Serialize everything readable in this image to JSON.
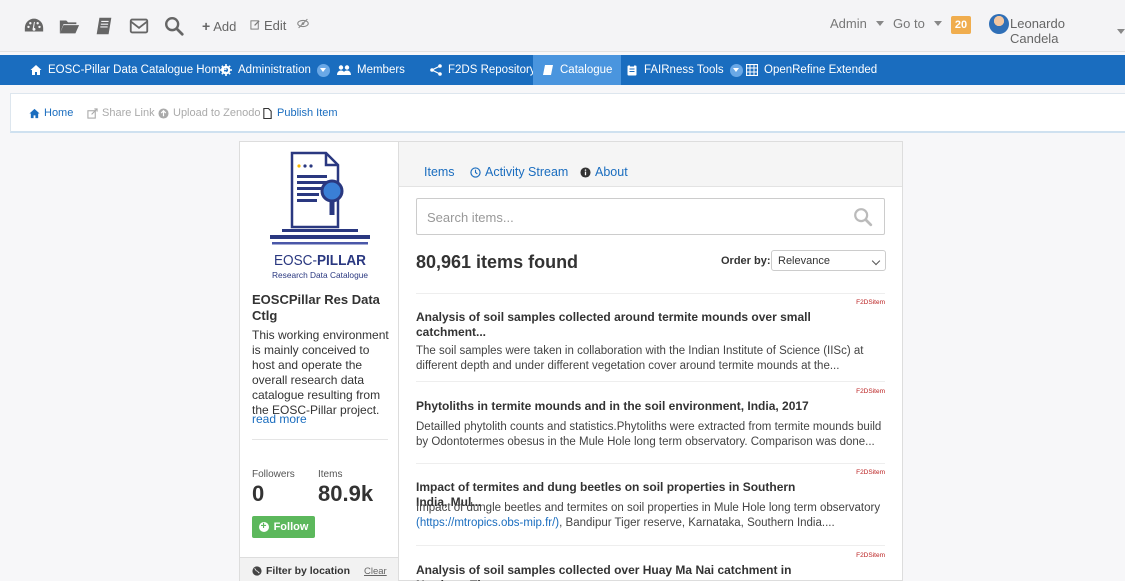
{
  "toolbar": {
    "add_label": "Add",
    "edit_label": "Edit",
    "admin_label": "Admin",
    "goto_label": "Go to",
    "notifications": "20",
    "user_name": "Leonardo Candela"
  },
  "nav": {
    "items": [
      {
        "label": "EOSC-Pillar Data Catalogue Home"
      },
      {
        "label": "Administration"
      },
      {
        "label": "Members"
      },
      {
        "label": "F2DS Repository"
      },
      {
        "label": "Catalogue"
      },
      {
        "label": "FAIRness Tools"
      },
      {
        "label": "OpenRefine Extended"
      }
    ]
  },
  "subbar": {
    "home": "Home",
    "share": "Share Link",
    "upload": "Upload to Zenodo",
    "publish": "Publish Item"
  },
  "org": {
    "logo_title_1": "EOSC-",
    "logo_title_2": "PILLAR",
    "logo_subtitle": "Research Data Catalogue",
    "name": "EOSCPillar Res Data Ctlg",
    "description": "This working environment is mainly conceived to host and operate the overall research data catalogue resulting from the EOSC-Pillar project.",
    "read_more": "read more",
    "followers_label": "Followers",
    "followers": "0",
    "items_label": "Items",
    "items": "80.9k",
    "follow_label": "Follow",
    "filter_label": "Filter by location",
    "filter_clear": "Clear"
  },
  "main": {
    "tabs": [
      {
        "label": "Items"
      },
      {
        "label": "Activity Stream"
      },
      {
        "label": "About"
      }
    ],
    "search_placeholder": "Search items...",
    "count": "80,961 items found",
    "order_label": "Order by:",
    "order_value": "Relevance",
    "results": [
      {
        "tag": "F2DSitem",
        "title": "Analysis of soil samples collected around termite mounds over small catchment...",
        "description": "The soil samples were taken in collaboration with the Indian Institute of Science (IISc) at different depth and under different vegetation cover around termite mounds at the..."
      },
      {
        "tag": "F2DSitem",
        "title": "Phytoliths in termite mounds and in the soil environment, India, 2017",
        "description": "Detailled phytolith counts and statistics.Phytoliths were extracted from termite mounds build by Odontotermes obesus in the Mule Hole long term observatory. Comparison was done..."
      },
      {
        "tag": "F2DSitem",
        "title": "Impact of termites and dung beetles on soil properties in Southern India, Mul...",
        "description_pre": "Impact of dungle beetles and termites on soil properties in Mule Hole long term observatory ",
        "description_link": "(https://mtropics.obs-mip.fr/)",
        "description_post": ", Bandipur Tiger reserve, Karnataka, Southern India...."
      },
      {
        "tag": "F2DSitem",
        "title": "Analysis of soil samples collected over Huay Ma Nai catchment in Northern Tha..."
      }
    ]
  },
  "colors": {
    "nav": "#1a6dbf",
    "nav_active": "#4a95de",
    "follow": "#5cb85c",
    "badge": "#f0ad4e"
  }
}
